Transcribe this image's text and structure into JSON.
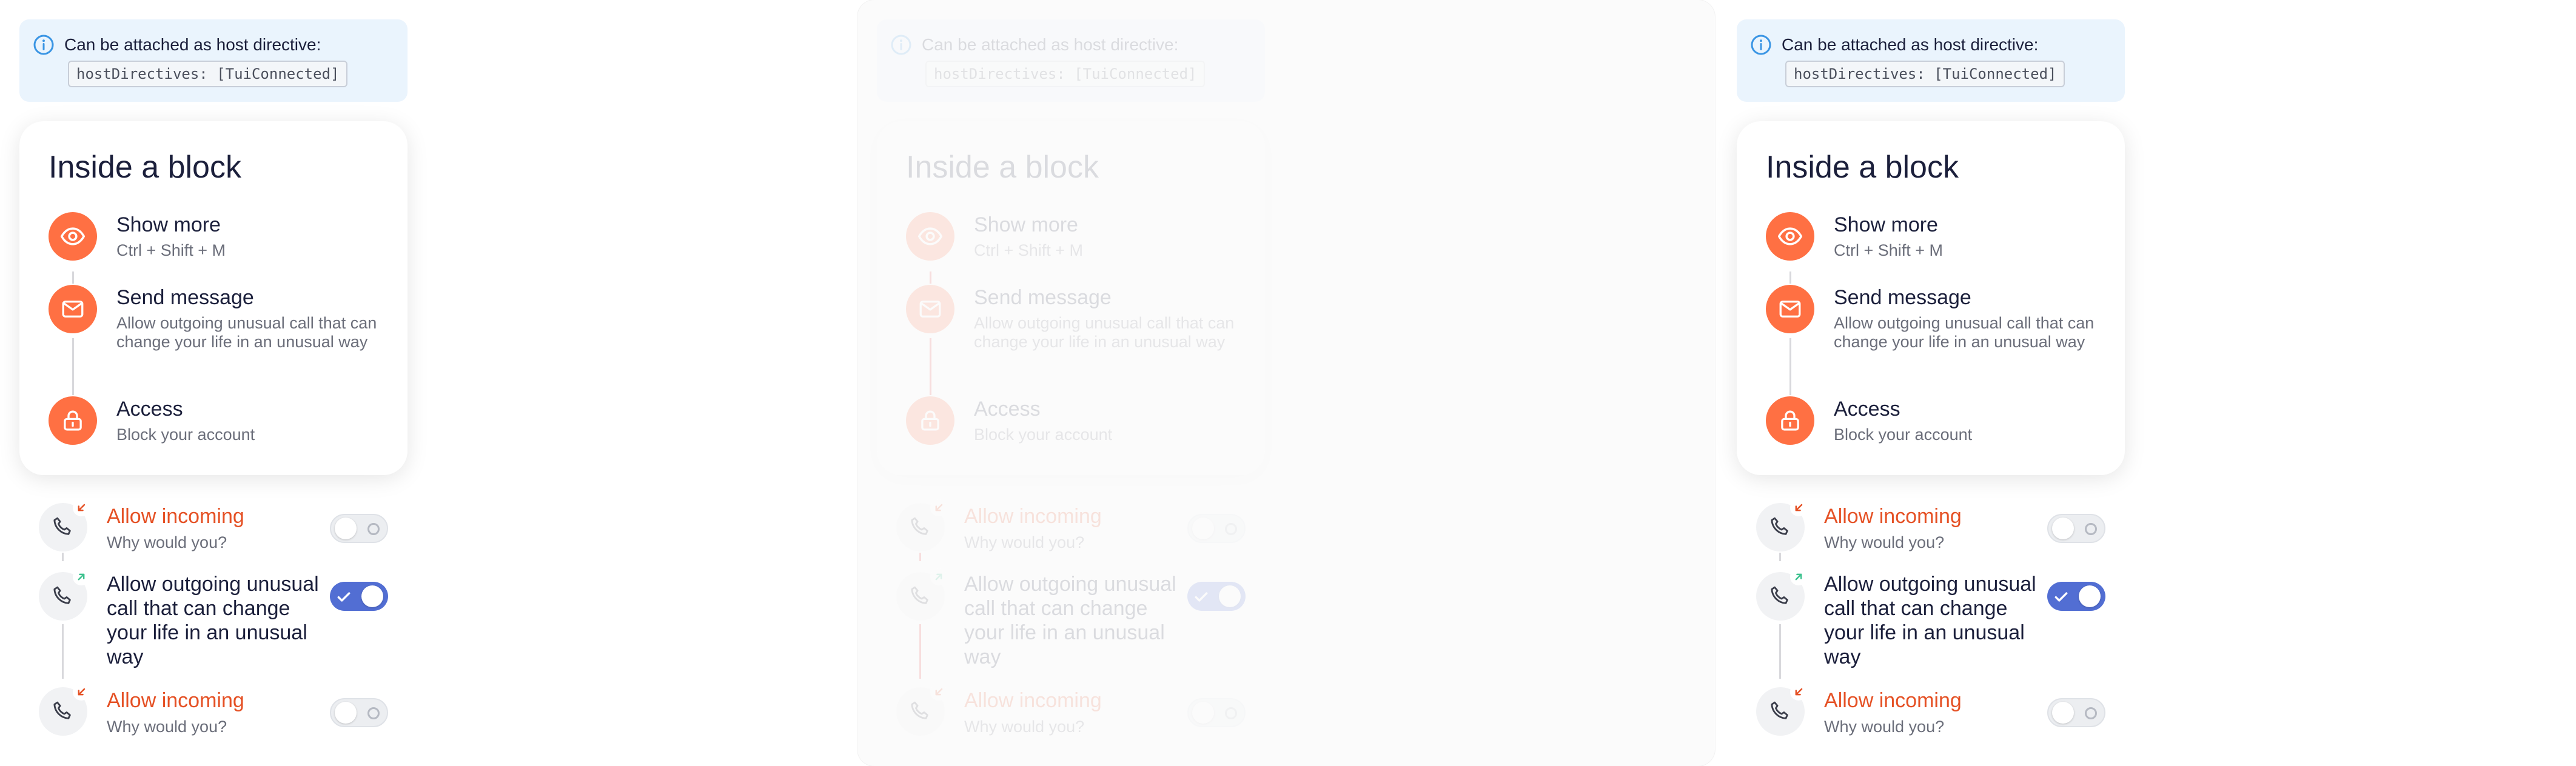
{
  "notice": {
    "text": "Can be attached as host directive:",
    "code": "hostDirectives: [TuiConnected]",
    "icon": "info-icon"
  },
  "block": {
    "title": "Inside a block",
    "steps": [
      {
        "title": "Show more",
        "description": "Ctrl + Shift + M",
        "icon": "eye-icon"
      },
      {
        "title": "Send message",
        "description": "Allow outgoing unusual call that can change your life in an unusual way",
        "icon": "mail-icon"
      },
      {
        "title": "Access",
        "description": "Block your account",
        "icon": "lock-icon"
      }
    ]
  },
  "cells": [
    {
      "title": "Allow incoming",
      "description": "Why would you?",
      "icon": "phone-incoming-icon",
      "checked": false
    },
    {
      "title": "Allow outgoing unusual call that can change your life in an unusual way",
      "description": "",
      "icon": "phone-outgoing-icon",
      "checked": true
    },
    {
      "title": "Allow incoming",
      "description": "Why would you?",
      "icon": "phone-incoming-icon",
      "checked": false
    }
  ],
  "colors": {
    "accent": "#ff7043",
    "incoming_badge": "#e55125",
    "outgoing_badge": "#3ec28f",
    "toggle_on": "#526ed3",
    "notice_bg": "#eaf4fd"
  }
}
